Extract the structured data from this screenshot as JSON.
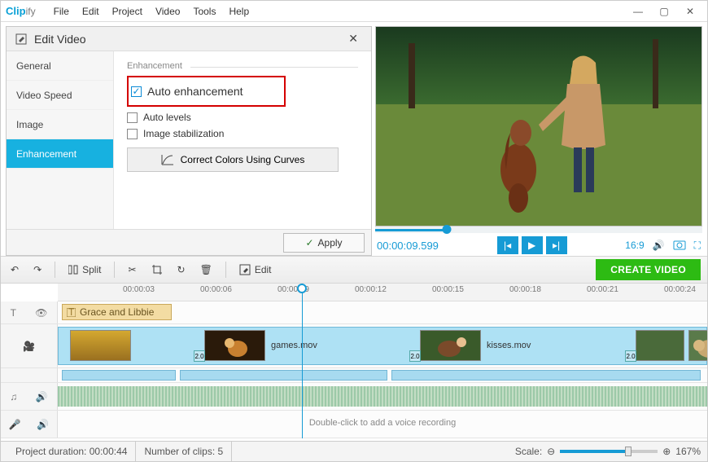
{
  "app": {
    "name": "Clipify",
    "name_suffix": "ify"
  },
  "menu": [
    "File",
    "Edit",
    "Project",
    "Video",
    "Tools",
    "Help"
  ],
  "panel": {
    "title": "Edit Video",
    "tabs": [
      "General",
      "Video Speed",
      "Image",
      "Enhancement"
    ],
    "active_tab": 3,
    "section": "Enhancement",
    "options": {
      "auto_enhancement": "Auto enhancement",
      "auto_levels": "Auto levels",
      "image_stabilization": "Image stabilization"
    },
    "curves_button": "Correct Colors Using Curves",
    "apply": "Apply"
  },
  "preview": {
    "timecode": "00:00:09.599",
    "aspect": "16:9"
  },
  "toolbar": {
    "split": "Split",
    "edit": "Edit",
    "create": "CREATE VIDEO"
  },
  "ruler": [
    "00:00:03",
    "00:00:06",
    "00:00:09",
    "00:00:12",
    "00:00:15",
    "00:00:18",
    "00:00:21",
    "00:00:24"
  ],
  "tracks": {
    "title_clip": "Grace and Libbie",
    "clip1": "games.mov",
    "clip2": "kisses.mov",
    "fx": "2.0",
    "voice_hint": "Double-click to add a voice recording"
  },
  "status": {
    "duration_label": "Project duration:",
    "duration": "00:00:44",
    "clips_label": "Number of clips:",
    "clips": "5",
    "scale_label": "Scale:",
    "scale_value": "167%"
  }
}
